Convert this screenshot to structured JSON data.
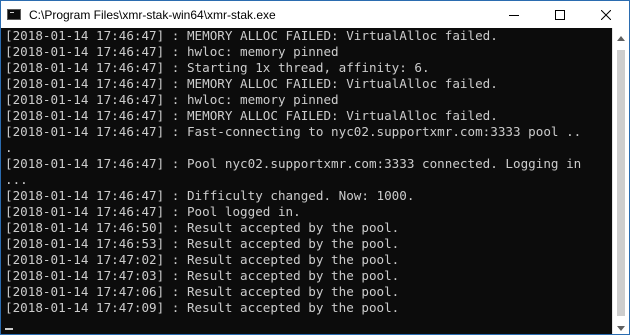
{
  "window": {
    "title": "C:\\Program Files\\xmr-stak-win64\\xmr-stak.exe"
  },
  "titlebar_buttons": [
    {
      "name": "minimize",
      "icon": "minimize-icon"
    },
    {
      "name": "maximize",
      "icon": "maximize-icon"
    },
    {
      "name": "close",
      "icon": "close-icon"
    }
  ],
  "console": {
    "lines": [
      "[2018-01-14 17:46:47] : MEMORY ALLOC FAILED: VirtualAlloc failed.",
      "[2018-01-14 17:46:47] : hwloc: memory pinned",
      "[2018-01-14 17:46:47] : Starting 1x thread, affinity: 6.",
      "[2018-01-14 17:46:47] : MEMORY ALLOC FAILED: VirtualAlloc failed.",
      "[2018-01-14 17:46:47] : hwloc: memory pinned",
      "[2018-01-14 17:46:47] : MEMORY ALLOC FAILED: VirtualAlloc failed.",
      "[2018-01-14 17:46:47] : Fast-connecting to nyc02.supportxmr.com:3333 pool ..",
      ".",
      "[2018-01-14 17:46:47] : Pool nyc02.supportxmr.com:3333 connected. Logging in",
      "...",
      "[2018-01-14 17:46:47] : Difficulty changed. Now: 1000.",
      "[2018-01-14 17:46:47] : Pool logged in.",
      "[2018-01-14 17:46:50] : Result accepted by the pool.",
      "[2018-01-14 17:46:53] : Result accepted by the pool.",
      "[2018-01-14 17:47:02] : Result accepted by the pool.",
      "[2018-01-14 17:47:03] : Result accepted by the pool.",
      "[2018-01-14 17:47:06] : Result accepted by the pool.",
      "[2018-01-14 17:47:09] : Result accepted by the pool."
    ]
  },
  "colors": {
    "console_background": "#0c0c0c",
    "console_text": "#cccccc",
    "titlebar_background": "#ffffff"
  }
}
